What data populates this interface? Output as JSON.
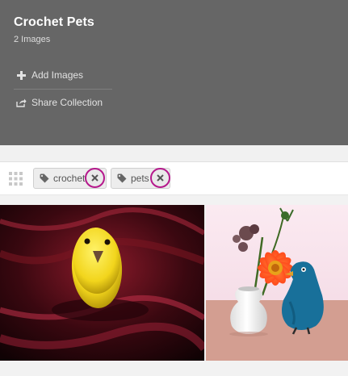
{
  "collection": {
    "title": "Crochet Pets",
    "image_count": "2 Images"
  },
  "actions": {
    "add_images": "Add Images",
    "share_collection": "Share Collection"
  },
  "tags": [
    {
      "label": "crochet"
    },
    {
      "label": "pets"
    }
  ],
  "icons": {
    "add": "plus-icon",
    "share": "share-icon",
    "drag": "grid-handle-icon",
    "tag": "tag-icon",
    "remove": "close-icon"
  },
  "colors": {
    "header_bg": "#666666",
    "highlight_ring": "#b5198c"
  }
}
